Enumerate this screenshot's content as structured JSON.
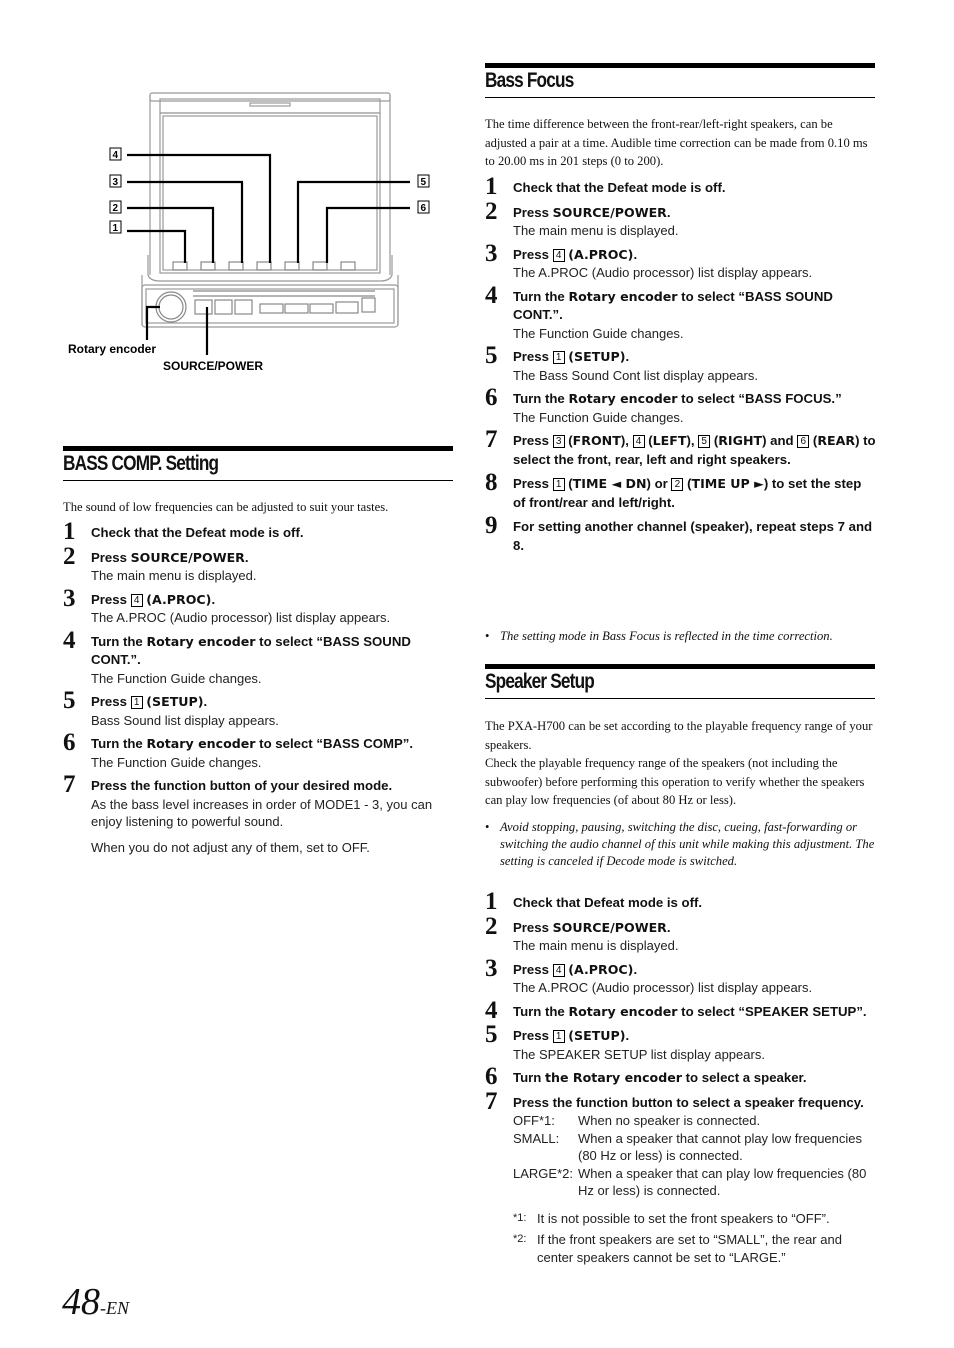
{
  "diagram": {
    "callouts": [
      "4",
      "3",
      "2",
      "1",
      "5",
      "6"
    ],
    "label_rotary": "Rotary encoder",
    "label_source": "SOURCE/POWER"
  },
  "bass_comp": {
    "title": "BASS COMP. Setting",
    "intro": "The sound of low frequencies can be adjusted to suit your tastes.",
    "steps": [
      {
        "n": "1",
        "main": "Check that the Defeat mode is off."
      },
      {
        "n": "2",
        "pre": "Press ",
        "kw": "SOURCE/POWER",
        "post": ".",
        "sub": "The main menu is displayed."
      },
      {
        "n": "3",
        "pre": "Press ",
        "box": "4",
        "kw": "(A.PROC)",
        "post": ".",
        "sub": "The A.PROC (Audio processor) list display appears."
      },
      {
        "n": "4",
        "pre": "Turn the ",
        "kw": "Rotary encoder",
        "post": " to select “BASS SOUND CONT.”.",
        "sub": "The Function Guide changes."
      },
      {
        "n": "5",
        "pre": "Press ",
        "box": "1",
        "kw": "(SETUP)",
        "post": ".",
        "sub": "Bass Sound list display appears."
      },
      {
        "n": "6",
        "pre": "Turn the ",
        "kw": "Rotary encoder",
        "post": " to select “BASS COMP”.",
        "sub": "The Function Guide changes."
      },
      {
        "n": "7",
        "main": "Press the function button of your desired mode.",
        "sub": "As the bass level increases in order of MODE1 - 3, you can enjoy listening to powerful sound.",
        "sub2": "When you do not adjust any of them, set to OFF."
      }
    ]
  },
  "bass_focus": {
    "title": "Bass Focus",
    "intro": "The time difference between the front-rear/left-right speakers, can be adjusted a pair at a time. Audible time correction can be made from 0.10 ms to 20.00 ms in 201 steps (0 to 200).",
    "steps": [
      {
        "n": "1",
        "main": "Check that the Defeat mode is off."
      },
      {
        "n": "2",
        "pre": "Press ",
        "kw": "SOURCE/POWER",
        "post": ".",
        "sub": "The main menu is displayed."
      },
      {
        "n": "3",
        "pre": "Press ",
        "box": "4",
        "kw": "(A.PROC)",
        "post": ".",
        "sub": "The A.PROC (Audio processor) list display appears."
      },
      {
        "n": "4",
        "pre": "Turn the ",
        "kw": "Rotary encoder",
        "post": " to select “BASS SOUND CONT.”.",
        "sub": "The Function Guide changes."
      },
      {
        "n": "5",
        "pre": "Press ",
        "box": "1",
        "kw": "(SETUP)",
        "post": ".",
        "sub": "The Bass Sound Cont list display appears."
      },
      {
        "n": "6",
        "pre": "Turn the ",
        "kw": "Rotary encoder",
        "post": " to select “BASS FOCUS.”",
        "sub": "The Function Guide changes."
      },
      {
        "n": "7",
        "html_parts": [
          "Press ",
          "[3]",
          " (",
          "FRONT",
          "), ",
          "[4]",
          " (",
          "LEFT",
          "), ",
          "[5]",
          " (",
          "RIGHT",
          ") and ",
          "[6]",
          " (",
          "REAR",
          ") to select the front, rear, left and right speakers."
        ]
      },
      {
        "n": "8",
        "html_parts": [
          "Press ",
          "[1]",
          " (",
          "TIME ◄ DN",
          ") or ",
          "[2]",
          " (",
          "TIME UP ►",
          ") to set the step of front/rear and left/right."
        ]
      },
      {
        "n": "9",
        "main": "For setting another channel (speaker), repeat steps 7 and 8."
      }
    ],
    "note": "The setting mode in Bass Focus is reflected in the time correction."
  },
  "speaker_setup": {
    "title": "Speaker Setup",
    "intro1": "The PXA-H700 can be set according to the playable frequency range of your speakers.",
    "intro2": "Check the playable frequency range of the speakers (not including the subwoofer) before performing this operation to verify whether the speakers can play low frequencies (of about 80 Hz or less).",
    "note": "Avoid stopping, pausing, switching the disc, cueing, fast-forwarding or switching the audio channel of this unit while making this adjustment. The setting is canceled if Decode mode is switched.",
    "steps": [
      {
        "n": "1",
        "main": "Check that Defeat mode is off."
      },
      {
        "n": "2",
        "pre": "Press ",
        "kw": "SOURCE/POWER",
        "post": ".",
        "sub": "The main menu is displayed."
      },
      {
        "n": "3",
        "pre": "Press ",
        "box": "4",
        "kw": "(A.PROC)",
        "post": ".",
        "sub": "The A.PROC (Audio processor) list display appears."
      },
      {
        "n": "4",
        "pre": "Turn the ",
        "kw": "Rotary encoder",
        "post": " to select “SPEAKER SETUP”."
      },
      {
        "n": "5",
        "pre": "Press ",
        "box": "1",
        "kw": "(SETUP)",
        "post": ".",
        "sub": "The SPEAKER SETUP list display appears."
      },
      {
        "n": "6",
        "pre": "Turn ",
        "kw": "the Rotary encoder",
        "post": " to select a speaker."
      },
      {
        "n": "7",
        "main": "Press the function button to select a speaker frequency."
      }
    ],
    "options": [
      {
        "key": "OFF*1:",
        "desc": "When no speaker is connected."
      },
      {
        "key": "SMALL:",
        "desc": "When a speaker that cannot play low frequencies (80 Hz or less) is connected."
      },
      {
        "key": "LARGE*2:",
        "desc": "When a speaker that can play low frequencies (80 Hz or less) is connected."
      }
    ],
    "footnotes": [
      {
        "key": "*1:",
        "text": "It is not possible to set the front speakers to “OFF”."
      },
      {
        "key": "*2:",
        "text": "If the front speakers are set to “SMALL”, the rear and center speakers cannot be set to “LARGE.”"
      }
    ]
  },
  "page": {
    "number": "48",
    "suffix": "-EN"
  }
}
